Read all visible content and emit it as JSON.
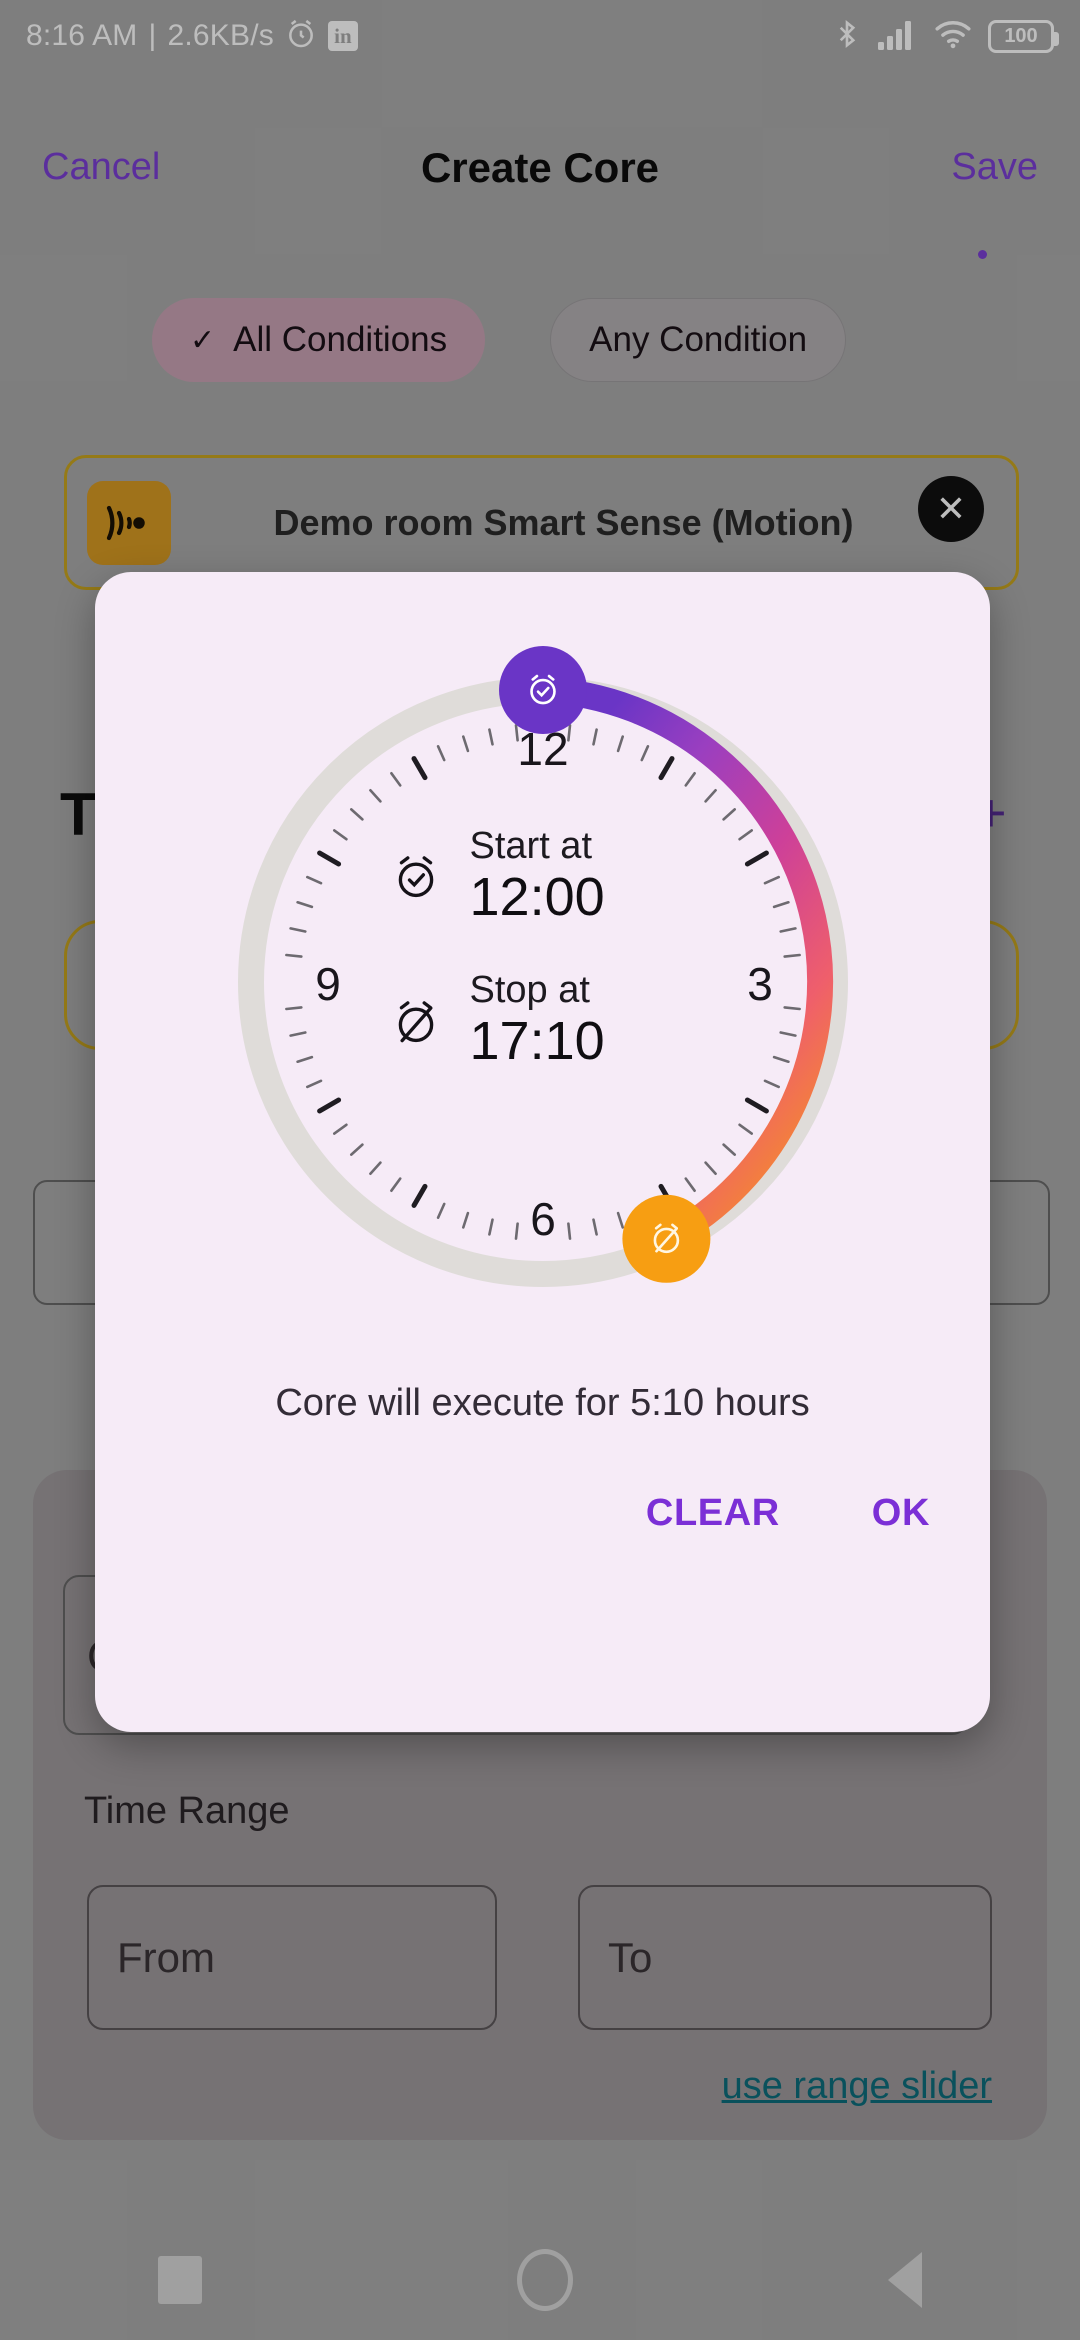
{
  "status_bar": {
    "time": "8:16 AM",
    "separator": "|",
    "network_speed": "2.6KB/s",
    "alarm_icon": "alarm-clock-icon",
    "app_icon": "linkedin-icon",
    "app_icon_glyph": "in",
    "bluetooth_icon": "bluetooth-icon",
    "signal_icon": "cellular-signal-icon",
    "wifi_icon": "wifi-icon",
    "battery_icon": "battery-icon",
    "battery_level": "100"
  },
  "app_bar": {
    "cancel_label": "Cancel",
    "title": "Create Core",
    "save_label": "Save",
    "accent_color": "#7b3fd4"
  },
  "condition_chips": [
    {
      "label": "All Conditions",
      "selected": true,
      "check_glyph": "✓",
      "bg_color": "#c9a3b4"
    },
    {
      "label": "Any Condition",
      "selected": false,
      "check_glyph": "",
      "bg_color": "#b4b0b2"
    }
  ],
  "device_condition": {
    "label": "Demo room Smart Sense (Motion)",
    "icon": "motion-sensor-icon",
    "icon_bg_color": "#d79a24",
    "border_color": "#caa520",
    "close_glyph": "✕"
  },
  "background_content": {
    "trigger_title": "T",
    "add_glyph": "+",
    "panel_field_placeholder": "C"
  },
  "time_range_section": {
    "label": "Time Range",
    "from_placeholder": "From",
    "to_placeholder": "To",
    "range_slider_link": "use range slider",
    "link_color": "#0d6e7d"
  },
  "time_dialog": {
    "start": {
      "label": "Start at",
      "value": "12:00",
      "icon": "alarm-check-icon",
      "handle_color": "#6a35c6"
    },
    "stop": {
      "label": "Stop at",
      "value": "17:10",
      "icon": "alarm-off-icon",
      "handle_color": "#f79e12"
    },
    "duration_text": "Core will execute for 5:10 hours",
    "clear_label": "CLEAR",
    "ok_label": "OK",
    "action_color": "#7b2fd6",
    "surface_color": "#f6ebf7",
    "track_color": "#dfdcd9",
    "clock_numerals": [
      "12",
      "3",
      "6",
      "9"
    ],
    "gradient_stops": [
      "#6a35c6",
      "#9a3fc0",
      "#cd4099",
      "#ef5f6b",
      "#f79e12"
    ]
  },
  "nav_bar": {
    "recents_icon": "square-recents-icon",
    "home_icon": "circle-home-icon",
    "back_icon": "triangle-back-icon"
  }
}
